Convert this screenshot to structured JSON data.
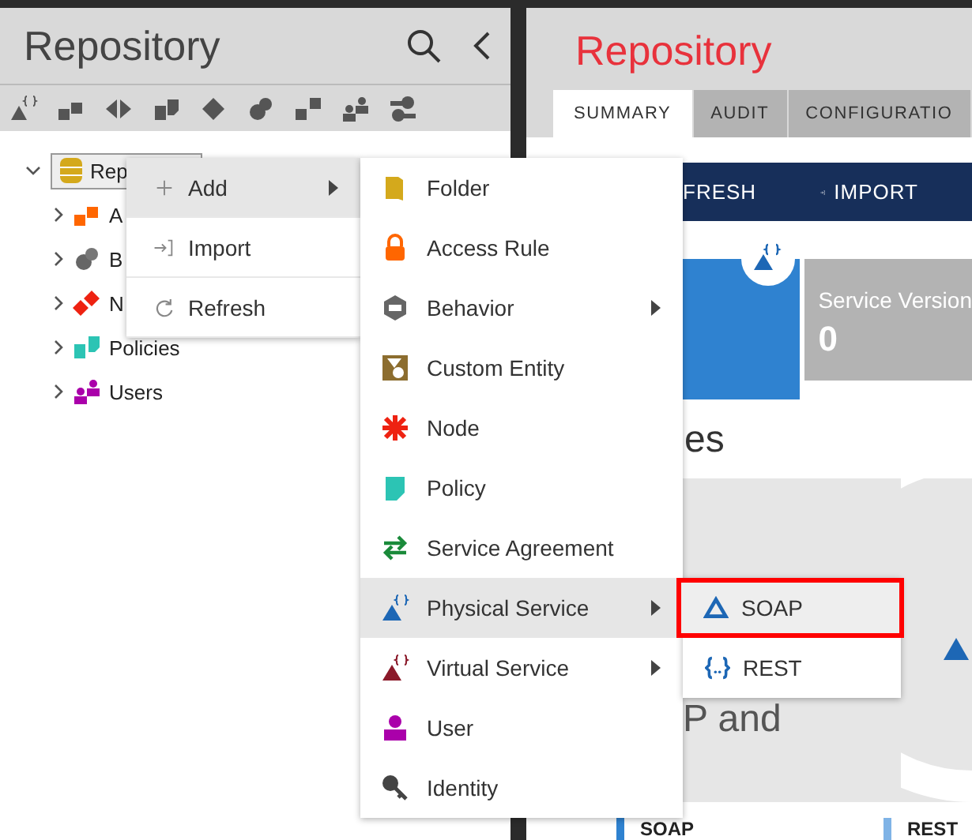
{
  "left_panel": {
    "title": "Repository",
    "tree": [
      {
        "label": "Rep",
        "expanded": true,
        "selected": true,
        "children": [
          {
            "label": "A",
            "expanded": false,
            "selected": false
          },
          {
            "label": "B",
            "expanded": false,
            "selected": false
          },
          {
            "label": "N",
            "expanded": false,
            "selected": false
          },
          {
            "label": "Policies",
            "expanded": false,
            "selected": false
          },
          {
            "label": "Users",
            "expanded": false,
            "selected": false
          }
        ]
      }
    ]
  },
  "right_panel": {
    "title": "Repository",
    "tabs": [
      {
        "label": "SUMMARY",
        "selected": true
      },
      {
        "label": "AUDIT",
        "selected": false
      },
      {
        "label": "CONFIGURATIO",
        "selected": false
      }
    ],
    "toolbar": [
      "FRESH",
      "IMPORT"
    ],
    "cards": [
      {
        "label": "Service Version",
        "value": "0"
      }
    ],
    "section_heading": "es",
    "chart_heading": "P and",
    "legend": [
      "SOAP",
      "REST"
    ]
  },
  "context_menu": [
    {
      "label": "Add",
      "selected": true,
      "has_submenu": true
    },
    {
      "label": "Import",
      "selected": false,
      "has_submenu": false
    },
    {
      "label": "Refresh",
      "selected": false,
      "has_submenu": false
    }
  ],
  "add_submenu": [
    {
      "label": "Folder",
      "selected": false,
      "has_submenu": false
    },
    {
      "label": "Access Rule",
      "selected": false,
      "has_submenu": false
    },
    {
      "label": "Behavior",
      "selected": false,
      "has_submenu": true
    },
    {
      "label": "Custom Entity",
      "selected": false,
      "has_submenu": false
    },
    {
      "label": "Node",
      "selected": false,
      "has_submenu": false
    },
    {
      "label": "Policy",
      "selected": false,
      "has_submenu": false
    },
    {
      "label": "Service Agreement",
      "selected": false,
      "has_submenu": false
    },
    {
      "label": "Physical Service",
      "selected": true,
      "has_submenu": true
    },
    {
      "label": "Virtual Service",
      "selected": false,
      "has_submenu": true
    },
    {
      "label": "User",
      "selected": false,
      "has_submenu": false
    },
    {
      "label": "Identity",
      "selected": false,
      "has_submenu": false
    }
  ],
  "physical_service_submenu": [
    {
      "label": "SOAP",
      "selected": true
    },
    {
      "label": "REST",
      "selected": false
    }
  ]
}
